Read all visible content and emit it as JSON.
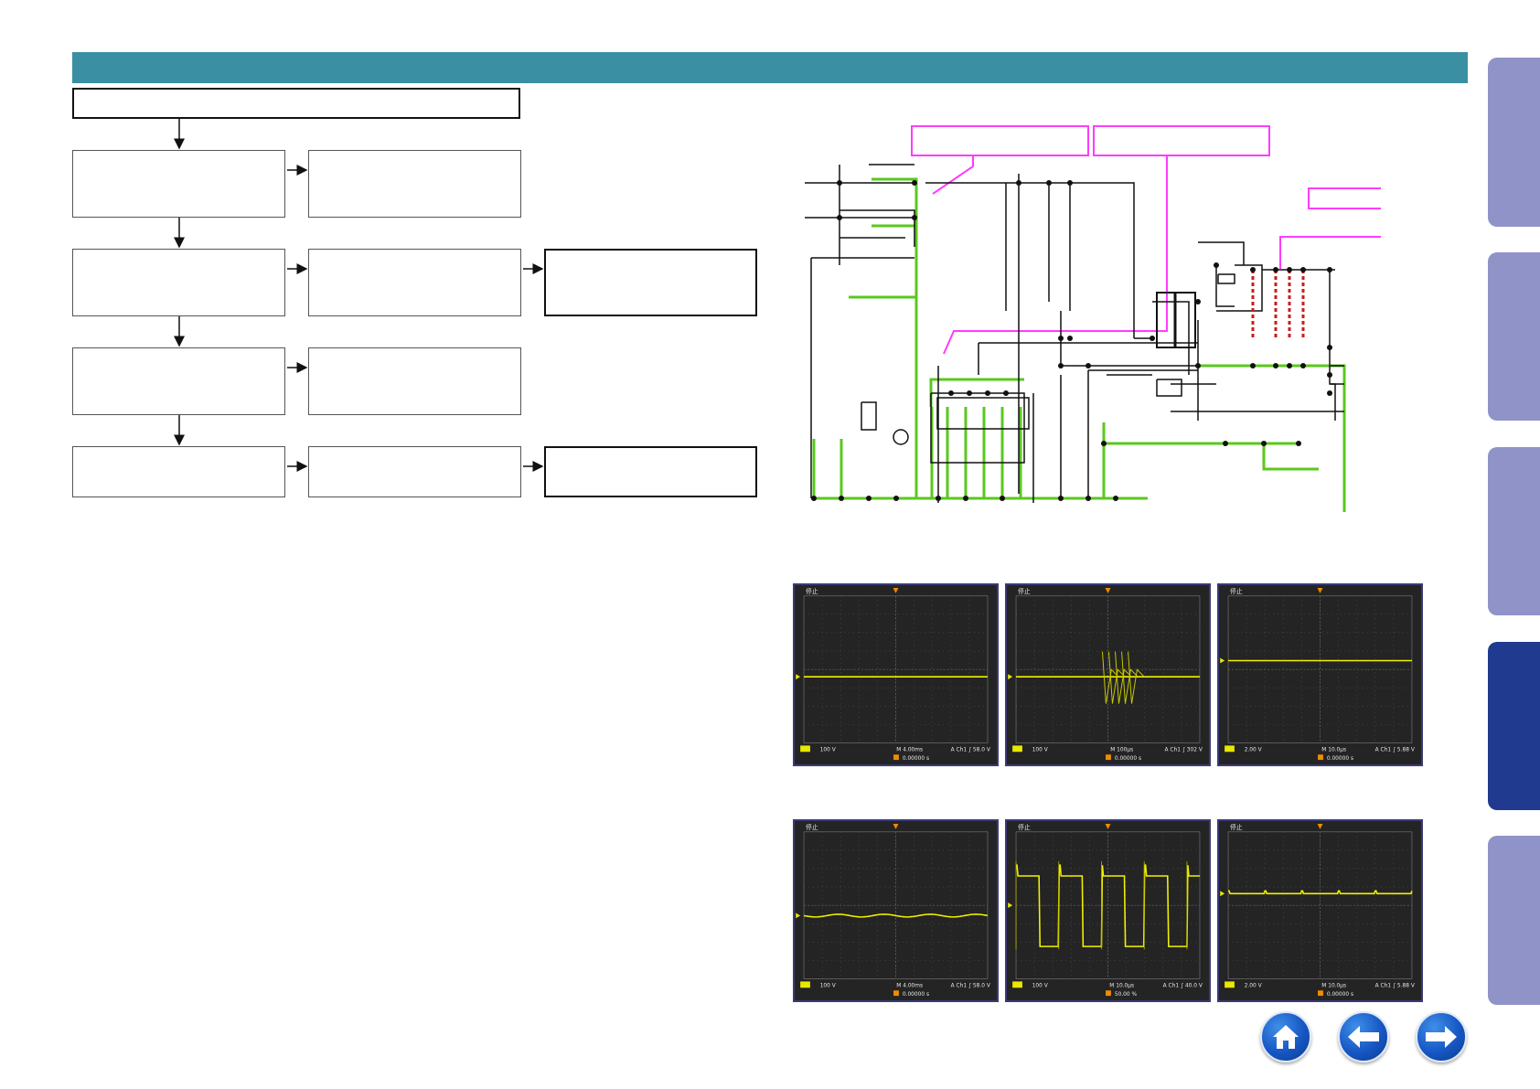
{
  "header": {
    "bar_color": "#3a8fa3"
  },
  "flowchart": {
    "top_box_text": "",
    "rows": [
      {
        "left": "",
        "mid": "",
        "right": null
      },
      {
        "left": "",
        "mid": "",
        "right": ""
      },
      {
        "left": "",
        "mid": "",
        "right": null
      },
      {
        "left": "",
        "mid": "",
        "right": ""
      }
    ]
  },
  "schematic": {
    "callouts": [
      "",
      "",
      ""
    ],
    "callout_color": "#ff3cff",
    "highlight_color": "#5ac81e"
  },
  "waveforms": {
    "status_text": "停止",
    "top_row": [
      {
        "ch": "100 V",
        "time": "M 4.00ms",
        "trig": "A  Ch1  ∫  58.0 V",
        "offset": "0.00000 s"
      },
      {
        "ch": "100 V",
        "time": "M 100μs",
        "trig": "A  Ch1  ∫  302 V",
        "offset": "0.00000 s"
      },
      {
        "ch": "2.00 V",
        "time": "M 10.0μs",
        "trig": "A  Ch1  ∫  5.88 V",
        "offset": "0.00000 s"
      }
    ],
    "bottom_row": [
      {
        "ch": "100 V",
        "time": "M 4.00ms",
        "trig": "A  Ch1  ∫  58.0 V",
        "offset": "0.00000 s"
      },
      {
        "ch": "100 V",
        "time": "M 10.0μs",
        "trig": "A  Ch1  ∫  40.0 V",
        "offset": "50.00 %"
      },
      {
        "ch": "2.00 V",
        "time": "M 10.0μs",
        "trig": "A  Ch1  ∫  5.88 V",
        "offset": "0.00000 s"
      }
    ]
  },
  "side_tabs": {
    "count": 5,
    "active_index": 3,
    "color": "#8f93c8",
    "active_color": "#1f3a8f"
  },
  "nav": {
    "home_icon": "home-icon",
    "back_icon": "arrow-left-icon",
    "next_icon": "arrow-right-icon"
  }
}
